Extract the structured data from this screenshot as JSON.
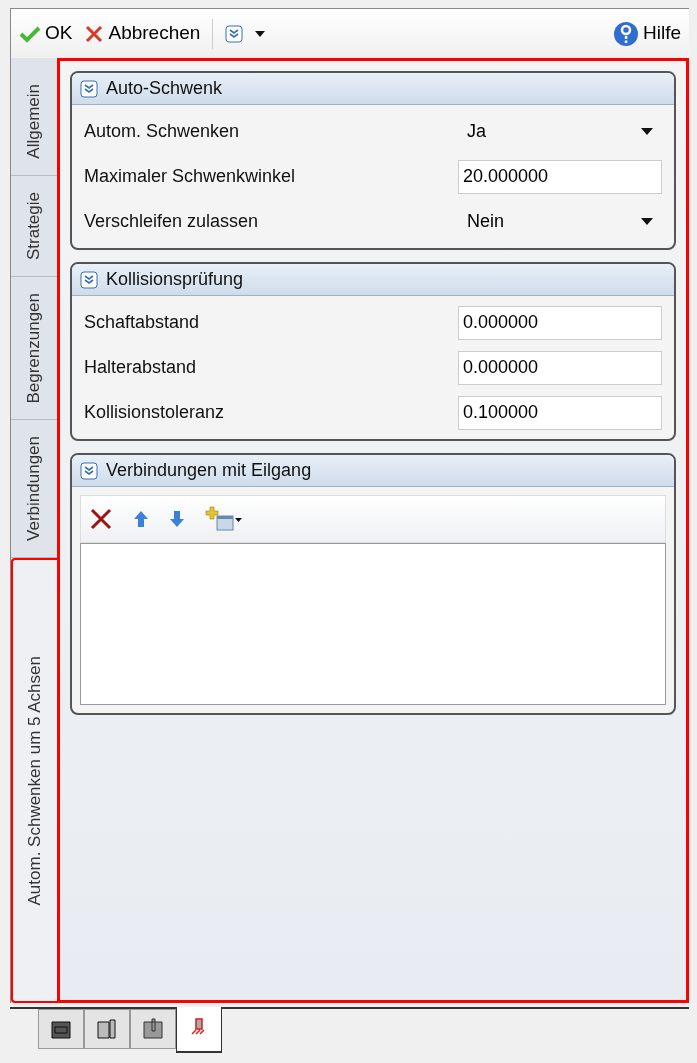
{
  "toolbar": {
    "ok": "OK",
    "cancel": "Abbrechen",
    "help": "Hilfe"
  },
  "side_tabs": [
    {
      "label": "Allgemein",
      "selected": false
    },
    {
      "label": "Strategie",
      "selected": false
    },
    {
      "label": "Begrenzungen",
      "selected": false
    },
    {
      "label": "Verbindungen",
      "selected": false
    },
    {
      "label": "Autom. Schwenken um 5 Achsen",
      "selected": true
    }
  ],
  "sections": [
    {
      "title": "Auto-Schwenk",
      "kind": "form",
      "rows": [
        {
          "label": "Autom. Schwenken",
          "kind": "dropdown",
          "value": "Ja"
        },
        {
          "label": "Maximaler Schwenkwinkel",
          "kind": "text",
          "value": "20.000000"
        },
        {
          "label": "Verschleifen zulassen",
          "kind": "dropdown",
          "value": "Nein"
        }
      ]
    },
    {
      "title": "Kollisionsprüfung",
      "kind": "form",
      "rows": [
        {
          "label": "Schaftabstand",
          "kind": "text",
          "value": "0.000000"
        },
        {
          "label": "Halterabstand",
          "kind": "text",
          "value": "0.000000"
        },
        {
          "label": "Kollisionstoleranz",
          "kind": "text",
          "value": "0.100000"
        }
      ]
    },
    {
      "title": "Verbindungen mit Eilgang",
      "kind": "list"
    }
  ],
  "bottom_tabs": [
    {
      "selected": false
    },
    {
      "selected": false
    },
    {
      "selected": false
    },
    {
      "selected": true
    }
  ]
}
